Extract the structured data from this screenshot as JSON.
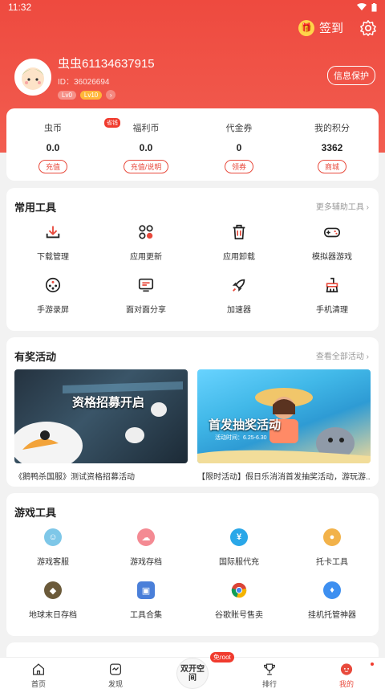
{
  "status": {
    "time": "11:32"
  },
  "header": {
    "checkin_label": "签到",
    "info_protect": "信息保护"
  },
  "profile": {
    "name": "虫虫61134637915",
    "id": "ID：36026694",
    "vip_level": "Lv0",
    "level": "Lv10"
  },
  "wallet": [
    {
      "label": "虫币",
      "value": "0.0",
      "action": "充值"
    },
    {
      "label": "福利币",
      "value": "0.0",
      "action": "充值/说明",
      "tag": "省钱"
    },
    {
      "label": "代金券",
      "value": "0",
      "action": "领券"
    },
    {
      "label": "我的积分",
      "value": "3362",
      "action": "商城"
    }
  ],
  "common_tools": {
    "title": "常用工具",
    "more": "更多辅助工具 ›",
    "items": [
      "下载管理",
      "应用更新",
      "应用卸载",
      "模拟器游戏",
      "手游录屏",
      "面对面分享",
      "加速器",
      "手机清理"
    ]
  },
  "activity": {
    "title": "有奖活动",
    "more": "查看全部活动 ›",
    "banners": [
      {
        "text": "资格招募开启",
        "caption": "《鹅鸭杀国服》测试资格招募活动"
      },
      {
        "text": "首发抽奖活动",
        "sub": "活动时间：6.25-6.30",
        "caption": "【限时活动】假日乐消消首发抽奖活动，游玩游..."
      }
    ]
  },
  "game_tools": {
    "title": "游戏工具",
    "items": [
      "游戏客服",
      "游戏存档",
      "国际服代充",
      "托卡工具",
      "地球末日存档",
      "工具合集",
      "谷歌账号售卖",
      "挂机托管神器"
    ]
  },
  "tabbar": {
    "tabs": [
      "首页",
      "发现",
      "双开空间",
      "排行",
      "我的"
    ],
    "root_badge": "免root"
  },
  "colors": {
    "brand": "#ee4a3f"
  }
}
